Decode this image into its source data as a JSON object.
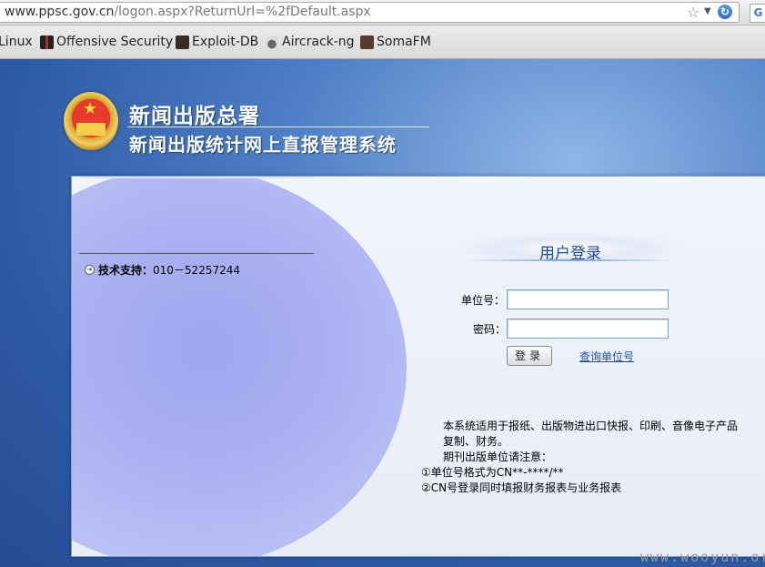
{
  "browser": {
    "url_host": "www.ppsc.gov.cn",
    "url_path": "/logon.aspx?ReturnUrl=%2fDefault.aspx",
    "icons": [
      "star-icon",
      "dropdown-icon",
      "reload-icon",
      "extension-icon"
    ]
  },
  "bookmarks": [
    {
      "label": "Linux",
      "icon": "none"
    },
    {
      "label": "Offensive Security",
      "icon": "offsec-icon"
    },
    {
      "label": "Exploit-DB",
      "icon": "exploitdb-icon"
    },
    {
      "label": "Aircrack-ng",
      "icon": "aircrack-icon"
    },
    {
      "label": "SomaFM",
      "icon": "somafm-icon"
    }
  ],
  "header": {
    "title": "新闻出版总署",
    "subtitle": "新闻出版统计网上直报管理系统",
    "emblem": "national-emblem-icon"
  },
  "support": {
    "label": "技术支持：",
    "phone": "010－52257244"
  },
  "login": {
    "title": "用户登录",
    "unit_label": "单位号：",
    "unit_value": "",
    "password_label": "密码：",
    "password_value": "",
    "submit_label": "登录",
    "query_link": "查询单位号"
  },
  "notice": {
    "line1": "本系统适用于报纸、出版物进出口快报、印刷、音像电子产品复制、财务。",
    "line2": "期刊出版单位请注意：",
    "line3": "①单位号格式为CN**-****/**",
    "line4": "②CN号登录同时填报财务报表与业务报表"
  },
  "watermark": "www.wooyun.org",
  "colors": {
    "page_background": "#2f5fa8",
    "login_title": "#1f4c94",
    "link": "#1d4fa5"
  }
}
